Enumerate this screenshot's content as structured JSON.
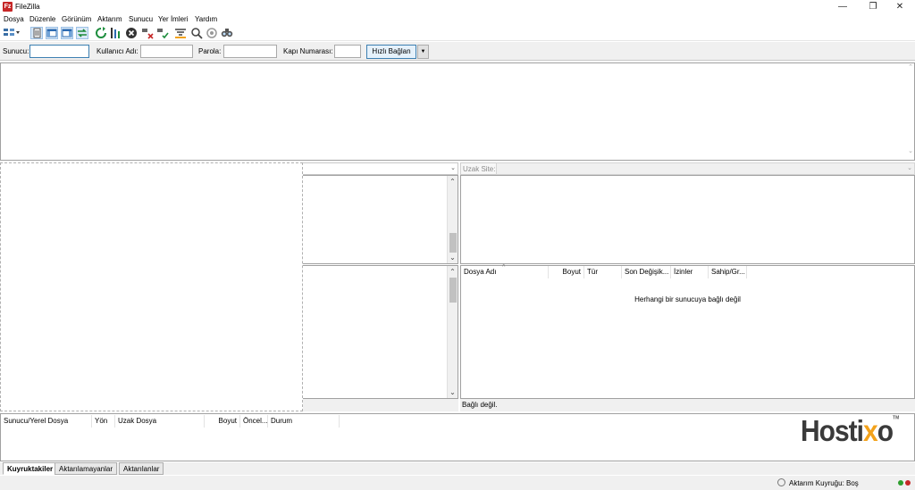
{
  "window": {
    "title": "FileZilla",
    "app_icon": "Fz",
    "min_glyph": "—",
    "max_glyph": "❐",
    "close_glyph": "✕"
  },
  "menu": [
    "Dosya",
    "Düzenle",
    "Görünüm",
    "Aktarım",
    "Sunucu",
    "Yer İmleri",
    "Yardım"
  ],
  "toolbar": {
    "icons": [
      "site-manager-icon",
      "toggle-log-icon",
      "toggle-local-tree-icon",
      "toggle-remote-tree-icon",
      "toggle-queue-icon",
      "refresh-icon",
      "process-queue-icon",
      "cancel-icon",
      "disconnect-icon",
      "reconnect-icon",
      "filter-icon",
      "compare-icon",
      "sync-browse-icon",
      "search-icon"
    ]
  },
  "quickconnect": {
    "host_label": "Sunucu:",
    "user_label": "Kullanıcı Adı:",
    "pass_label": "Parola:",
    "port_label": "Kapı Numarası:",
    "host_value": "",
    "user_value": "",
    "pass_value": "",
    "port_value": "",
    "button_label": "Hızlı Bağlan",
    "dropdown_glyph": "▼"
  },
  "remote": {
    "site_label": "Uzak Site:",
    "columns": [
      "Dosya Adı",
      "Boyut",
      "Tür",
      "Son Değişik...",
      "İzinler",
      "Sahip/Gr..."
    ],
    "empty_message": "Herhangi bir sunucuya bağlı değil",
    "status": "Bağlı değil."
  },
  "queue": {
    "columns": [
      "Sunucu/Yerel Dosya",
      "Yön",
      "Uzak Dosya",
      "Boyut",
      "Öncel...",
      "Durum"
    ],
    "watermark": {
      "pre": "Hosti",
      "x": "x",
      "post": "o",
      "tm": "TM"
    }
  },
  "tabs": [
    "Kuyruktakiler",
    "Aktarılamayanlar",
    "Aktarılanlar"
  ],
  "statusbar": {
    "queue_text": "Aktarım Kuyruğu: Boş",
    "led_colors": [
      "#2e9e2e",
      "#c62828"
    ]
  },
  "glyphs": {
    "up": "⌃",
    "down": "⌄",
    "chev": "⌄",
    "sort": "^"
  }
}
